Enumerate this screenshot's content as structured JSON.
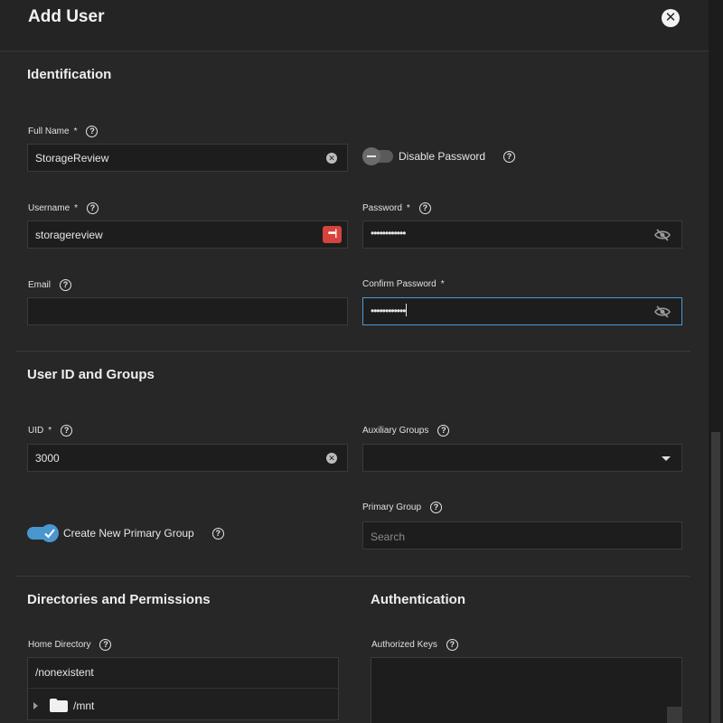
{
  "dialog": {
    "title": "Add User",
    "close_icon": "close-icon"
  },
  "identification": {
    "section_title": "Identification",
    "full_name": {
      "label": "Full Name",
      "required": "*",
      "value": "StorageReview"
    },
    "disable_password": {
      "label": "Disable Password",
      "enabled": false
    },
    "username": {
      "label": "Username",
      "required": "*",
      "value": "storagereview",
      "badge": "•••|"
    },
    "password": {
      "label": "Password",
      "required": "*",
      "value": "••••••••••••"
    },
    "email": {
      "label": "Email",
      "value": ""
    },
    "confirm_password": {
      "label": "Confirm Password",
      "required": "*",
      "value": "••••••••••••"
    }
  },
  "user_id_groups": {
    "section_title": "User ID and Groups",
    "uid": {
      "label": "UID",
      "required": "*",
      "value": "3000"
    },
    "auxiliary_groups": {
      "label": "Auxiliary Groups",
      "value": ""
    },
    "create_primary_group": {
      "label": "Create New Primary Group",
      "enabled": true
    },
    "primary_group": {
      "label": "Primary Group",
      "placeholder": "Search"
    }
  },
  "directories": {
    "section_title": "Directories and Permissions",
    "home_directory": {
      "label": "Home Directory",
      "value": "/nonexistent"
    },
    "tree": [
      {
        "name": "/mnt",
        "icon": "folder-icon"
      }
    ]
  },
  "authentication": {
    "section_title": "Authentication",
    "authorized_keys": {
      "label": "Authorized Keys",
      "value": ""
    }
  },
  "colors": {
    "panel": "#272727",
    "accent": "#4a97d0",
    "badge": "#d6433c"
  }
}
